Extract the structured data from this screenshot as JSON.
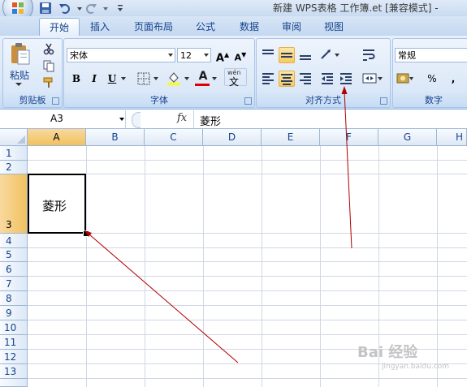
{
  "window": {
    "title": "新建 WPS表格 工作簿.et  [兼容模式] -"
  },
  "tabs": [
    {
      "label": "开始",
      "active": true
    },
    {
      "label": "插入",
      "active": false
    },
    {
      "label": "页面布局",
      "active": false
    },
    {
      "label": "公式",
      "active": false
    },
    {
      "label": "数据",
      "active": false
    },
    {
      "label": "审阅",
      "active": false
    },
    {
      "label": "视图",
      "active": false
    }
  ],
  "ribbon": {
    "clipboard": {
      "label": "剪贴板",
      "paste_label": "粘贴"
    },
    "font": {
      "label": "字体",
      "font_name": "宋体",
      "font_size": "12",
      "grow_label": "A",
      "shrink_label": "A",
      "bold": "B",
      "italic": "I",
      "underline": "U",
      "font_color_label": "A",
      "phonetic_label": "wén"
    },
    "alignment": {
      "label": "对齐方式"
    },
    "number": {
      "label": "数字",
      "format": "常规",
      "percent": "%",
      "comma": ","
    }
  },
  "formula_bar": {
    "name_box": "A3",
    "fx": "fx",
    "value": "菱形"
  },
  "columns": [
    "A",
    "B",
    "C",
    "D",
    "E",
    "F",
    "G",
    "H"
  ],
  "rows": [
    "1",
    "2",
    "3",
    "4",
    "5",
    "6",
    "7",
    "8",
    "9",
    "10",
    "11",
    "12",
    "13"
  ],
  "cells": {
    "A3": "菱形"
  },
  "selection": {
    "column": "A",
    "row": "3"
  },
  "colors": {
    "selection_header": "#f1c15f",
    "arrow": "#b00000",
    "ribbon_bg": "#dbe8f8"
  },
  "watermark": {
    "text": "Bai 经验",
    "sub": "jingyan.baidu.com"
  }
}
